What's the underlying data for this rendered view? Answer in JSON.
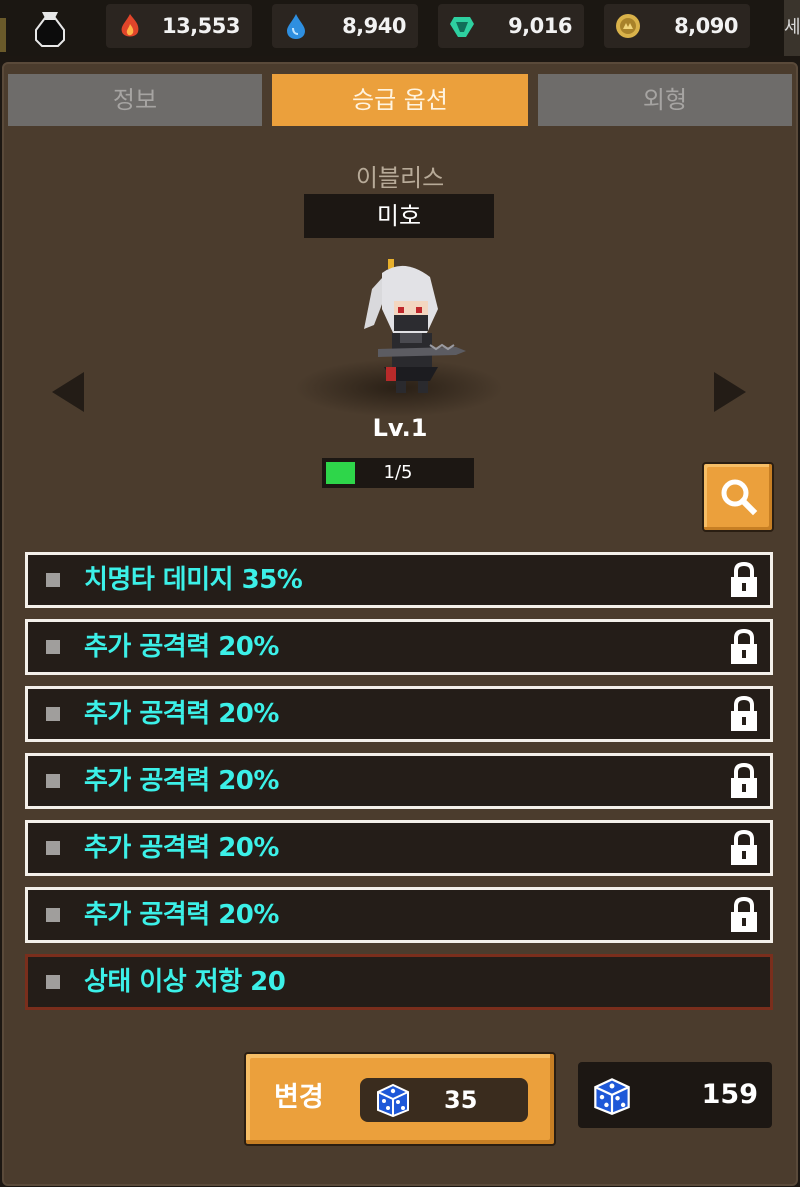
{
  "currencies": [
    {
      "name": "fire-gem",
      "value": "13,553",
      "color": "#e0452a"
    },
    {
      "name": "water-gem",
      "value": "8,940",
      "color": "#2e8fe0"
    },
    {
      "name": "green-gem",
      "value": "9,016",
      "color": "#2ed0a0"
    },
    {
      "name": "gold-coin",
      "value": "8,090",
      "color": "#d9b24a"
    }
  ],
  "edge_char": "세",
  "tabs": [
    {
      "label": "정보",
      "active": false
    },
    {
      "label": "승급 옵션",
      "active": true
    },
    {
      "label": "외형",
      "active": false
    }
  ],
  "hero": {
    "class_name": "이블리스",
    "name": "미호",
    "level": "Lv.1",
    "progress_text": "1/5",
    "progress_fraction": 0.2
  },
  "options": [
    {
      "label": "치명타 데미지 35%",
      "locked": true
    },
    {
      "label": "추가 공격력 20%",
      "locked": true
    },
    {
      "label": "추가 공격력 20%",
      "locked": true
    },
    {
      "label": "추가 공격력 20%",
      "locked": true
    },
    {
      "label": "추가 공격력 20%",
      "locked": true
    },
    {
      "label": "추가 공격력 20%",
      "locked": true
    },
    {
      "label": "상태 이상 저항 20",
      "locked": false
    }
  ],
  "change_button": {
    "label": "변경",
    "cost": "35"
  },
  "dice_owned": "159",
  "colors": {
    "accent": "#eba03c",
    "option_text": "#3cf0e8",
    "panel": "#4b3c2d"
  }
}
